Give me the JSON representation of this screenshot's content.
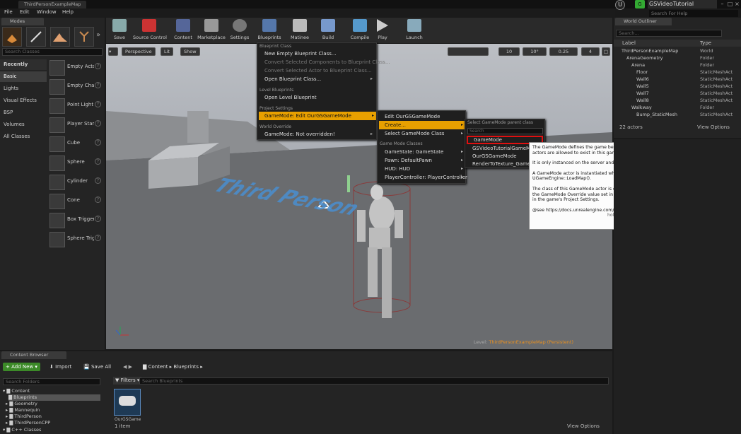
{
  "doc_tab": "ThirdPersonExampleMap",
  "menu": [
    "File",
    "Edit",
    "Window",
    "Help"
  ],
  "project": {
    "badge": "G",
    "name": "GSVideoTutorial",
    "search_placeholder": "Search For Help"
  },
  "modes": {
    "tab": "Modes",
    "search_placeholder": "Search Classes",
    "categories": [
      "Recently Placed",
      "Basic",
      "Lights",
      "Visual Effects",
      "BSP",
      "Volumes",
      "All Classes"
    ],
    "objects": [
      "Empty Actor",
      "Empty Character",
      "Point Light",
      "Player Start",
      "Cube",
      "Sphere",
      "Cylinder",
      "Cone",
      "Box Trigger",
      "Sphere Trigger"
    ]
  },
  "toolbar": [
    "Save",
    "Source Control",
    "Content",
    "Marketplace",
    "Settings",
    "Blueprints",
    "Matinee",
    "Build",
    "Compile",
    "Play",
    "Launch"
  ],
  "viewport": {
    "perspective": "Perspective",
    "lit": "Lit",
    "show": "Show",
    "grid": "10",
    "rot": "10°",
    "scale": "0.25",
    "cam": "4",
    "floor_text": "Third Person",
    "level_label": "Level:",
    "level_name": "ThirdPersonExampleMap (Persistent)"
  },
  "blueprints_menu": {
    "h1": "Blueprint Class",
    "items1": [
      "New Empty Blueprint Class...",
      "Convert Selected Components to Blueprint Class...",
      "Convert Selected Actor to Blueprint Class...",
      "Open Blueprint Class..."
    ],
    "h2": "Level Blueprints",
    "items2": [
      "Open Level Blueprint"
    ],
    "h3": "Project Settings",
    "items3": [
      "GameMode: Edit OurGSGameMode"
    ],
    "h4": "World Override",
    "items4": [
      "GameMode: Not overridden!"
    ]
  },
  "gamemode_menu": {
    "items": [
      "Edit OurGSGameMode",
      "Create...",
      "Select GameMode Class"
    ],
    "h2": "Game Mode Classes",
    "classes": [
      "GameState: GameState",
      "Pawn: DefaultPawn",
      "HUD: HUD",
      "PlayerController: PlayerController"
    ]
  },
  "parent_menu": {
    "header": "Select GameMode parent class",
    "search_placeholder": "Search",
    "items": [
      "GameMode",
      "GSVideoTutorialGameMode",
      "OurGSGameMode",
      "RenderToTexture_Game"
    ]
  },
  "tooltip": {
    "p1": "The GameMode defines the game being played. It governs the game rules, scoring, what actors are allowed to exist in this game type, and who may enter the game.",
    "p2": "It is only instanced on the server and will never exist on the client.",
    "p3": "A GameMode actor is instantiated when the level is initialized for gameplay in C++ UGameEngine::LoadMap().",
    "p4": "The class of this GameMode actor is determined by (in order) either the URL ?game=xxx, the GameMode Override value set in the World Settings, or the DefaultGameMode entry set in the game's Project Settings.",
    "p5": "@see https://docs.unrealengine.com/latest/INT/Gameplay/Framework/GameMode/index.html",
    "hint": "hold (Ctrl + Alt) for more"
  },
  "outliner": {
    "tab": "World Outliner",
    "search_placeholder": "Search...",
    "col_label": "Label",
    "col_type": "Type",
    "rows": [
      {
        "l": "ThirdPersonExampleMap",
        "t": "World",
        "i": 0
      },
      {
        "l": "ArenaGeometry",
        "t": "Folder",
        "i": 1
      },
      {
        "l": "Arena",
        "t": "Folder",
        "i": 2
      },
      {
        "l": "Floor",
        "t": "StaticMeshAct",
        "i": 3
      },
      {
        "l": "Wall6",
        "t": "StaticMeshAct",
        "i": 3
      },
      {
        "l": "Wall5",
        "t": "StaticMeshAct",
        "i": 3
      },
      {
        "l": "Wall7",
        "t": "StaticMeshAct",
        "i": 3
      },
      {
        "l": "Wall8",
        "t": "StaticMeshAct",
        "i": 3
      },
      {
        "l": "Walkway",
        "t": "Folder",
        "i": 2
      },
      {
        "l": "Bump_StaticMesh",
        "t": "StaticMeshAct",
        "i": 3
      }
    ],
    "count": "22 actors",
    "view_options": "View Options"
  },
  "content_browser": {
    "tab": "Content Browser",
    "add_new": "Add New",
    "import": "Import",
    "save_all": "Save All",
    "path": [
      "Content",
      "Blueprints"
    ],
    "search_folders": "Search Folders",
    "filters": "Filters",
    "search_bp": "Search Blueprints",
    "folders": [
      "Content",
      "Blueprints",
      "Geometry",
      "Mannequin",
      "ThirdPerson",
      "ThirdPersonCPP",
      "C++ Classes"
    ],
    "asset": "OurGSGame",
    "count": "1 item",
    "view_options": "View Options"
  }
}
